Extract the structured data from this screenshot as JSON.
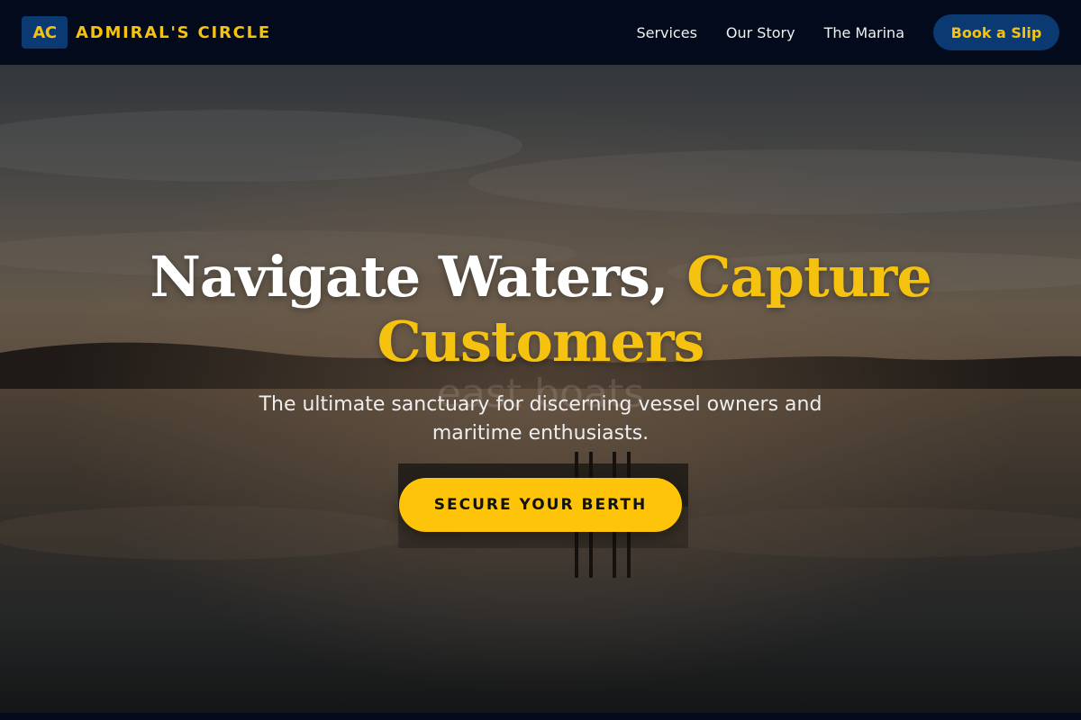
{
  "brand": {
    "logo_initials": "AC",
    "name": "ADMIRAL'S CIRCLE"
  },
  "nav": {
    "links": [
      {
        "label": "Services"
      },
      {
        "label": "Our Story"
      },
      {
        "label": "The Marina"
      }
    ],
    "cta_label": "Book a Slip"
  },
  "hero": {
    "headline_white": "Navigate Waters, ",
    "headline_accent": "Capture Customers",
    "subheadline": "The ultimate sanctuary for discerning vessel owners and maritime enthusiasts.",
    "cta_label": "SECURE YOUR BERTH",
    "watermark_text": "east boats"
  },
  "colors": {
    "accent": "#f5c20f",
    "navy": "#0b3a73",
    "header_bg": "#030a1c"
  },
  "icons": {
    "logo": "ac-monogram-logo"
  }
}
